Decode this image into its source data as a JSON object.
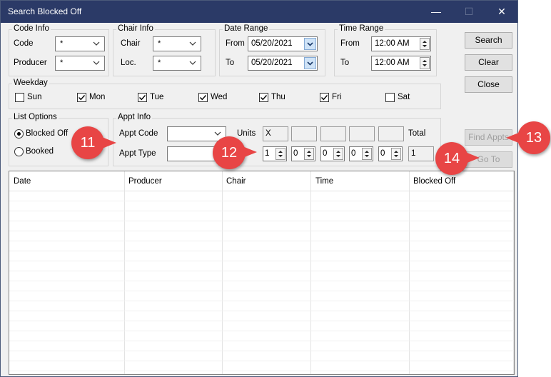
{
  "window": {
    "title": "Search Blocked Off",
    "minimize_glyph": "—",
    "maximize_glyph": "☐",
    "close_glyph": "✕"
  },
  "code_info": {
    "legend": "Code Info",
    "code_label": "Code",
    "code_value": "*",
    "producer_label": "Producer",
    "producer_value": "*"
  },
  "chair_info": {
    "legend": "Chair Info",
    "chair_label": "Chair",
    "chair_value": "*",
    "loc_label": "Loc.",
    "loc_value": "*"
  },
  "date_range": {
    "legend": "Date Range",
    "from_label": "From",
    "from_value": "05/20/2021",
    "to_label": "To",
    "to_value": "05/20/2021"
  },
  "time_range": {
    "legend": "Time Range",
    "from_label": "From",
    "from_value": "12:00 AM",
    "to_label": "To",
    "to_value": "12:00 AM"
  },
  "buttons": {
    "search": "Search",
    "clear": "Clear",
    "close": "Close",
    "find_appts": "Find Appts",
    "go_to": "Go To"
  },
  "weekday": {
    "legend": "Weekday",
    "days": [
      {
        "label": "Sun",
        "checked": false
      },
      {
        "label": "Mon",
        "checked": true
      },
      {
        "label": "Tue",
        "checked": true
      },
      {
        "label": "Wed",
        "checked": true
      },
      {
        "label": "Thu",
        "checked": true
      },
      {
        "label": "Fri",
        "checked": true
      },
      {
        "label": "Sat",
        "checked": false
      }
    ]
  },
  "list_options": {
    "legend": "List Options",
    "blocked_off": "Blocked Off",
    "booked": "Booked",
    "selected": "Blocked Off"
  },
  "appt_info": {
    "legend": "Appt Info",
    "appt_code_label": "Appt Code",
    "appt_code_value": "",
    "appt_type_label": "Appt Type",
    "appt_type_value": "",
    "units_label": "Units",
    "units": [
      "X",
      "",
      "",
      "",
      ""
    ],
    "total_label": "Total",
    "spinners": [
      "1",
      "0",
      "0",
      "0",
      "0"
    ],
    "total_value": "1"
  },
  "grid": {
    "columns": [
      "Date",
      "Producer",
      "Chair",
      "Time",
      "Blocked Off"
    ]
  },
  "callouts": {
    "c11": "11",
    "c12": "12",
    "c13": "13",
    "c14": "14"
  },
  "colors": {
    "titlebar": "#2b3a67",
    "callout": "#e84545",
    "date_dropdown": "#cfe3f7"
  }
}
